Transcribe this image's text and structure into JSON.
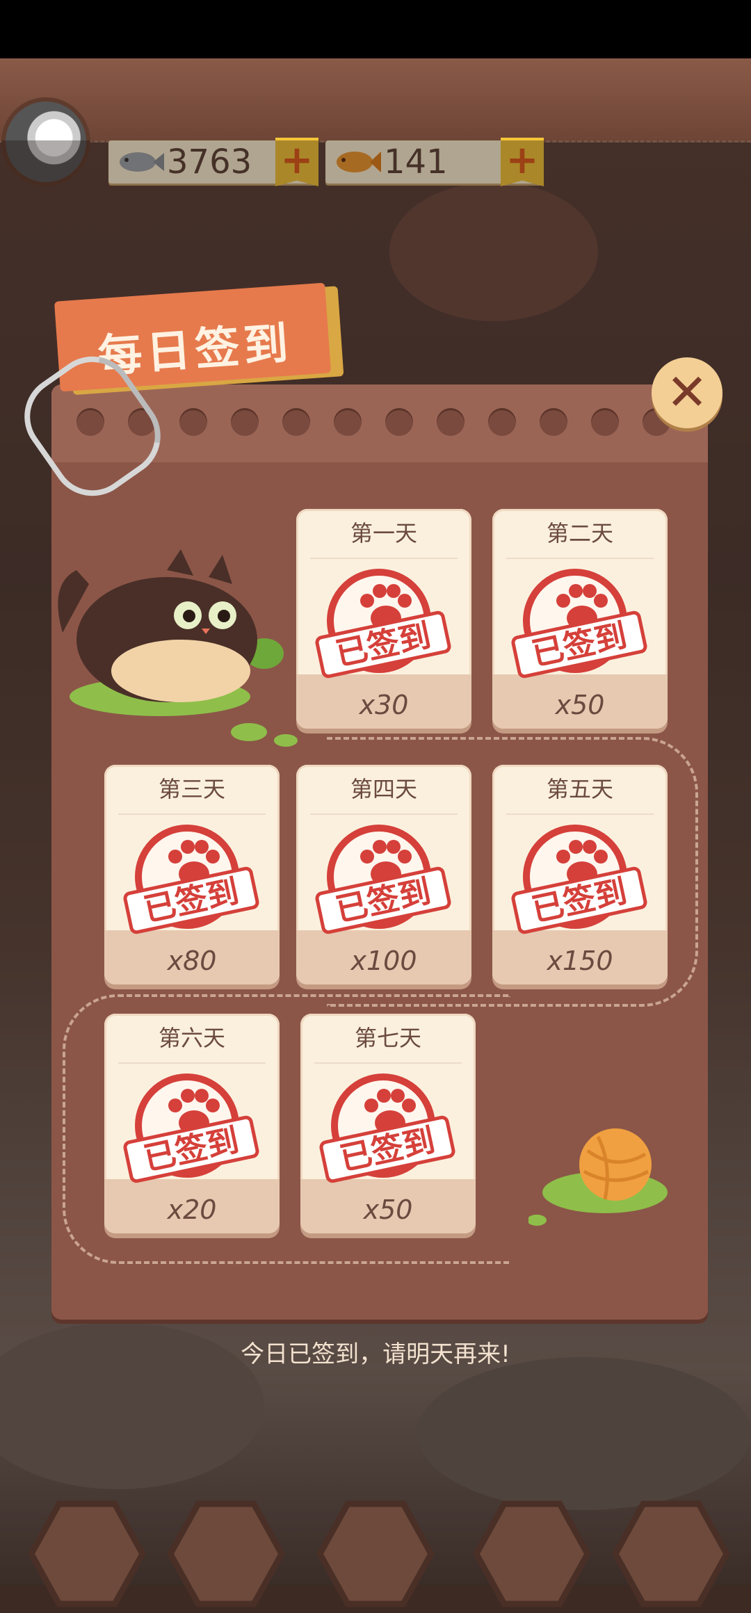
{
  "currency": {
    "fish_count": "3763",
    "gold_fish_count": "141",
    "plus_label": "+"
  },
  "dialog": {
    "title": "每日签到",
    "close_label": "✕",
    "days": [
      {
        "label": "第一天",
        "amount": "x30",
        "stamp": "已签到"
      },
      {
        "label": "第二天",
        "amount": "x50",
        "stamp": "已签到"
      },
      {
        "label": "第三天",
        "amount": "x80",
        "stamp": "已签到"
      },
      {
        "label": "第四天",
        "amount": "x100",
        "stamp": "已签到"
      },
      {
        "label": "第五天",
        "amount": "x150",
        "stamp": "已签到"
      },
      {
        "label": "第六天",
        "amount": "x20",
        "stamp": "已签到"
      },
      {
        "label": "第七天",
        "amount": "x50",
        "stamp": "已签到"
      }
    ]
  },
  "footer_message": "今日已签到，请明天再来!",
  "icons": {
    "avatar": "user-avatar",
    "fish": "fish-icon",
    "gold_fish": "gold-fish-icon",
    "close": "close-icon",
    "paw": "paw-icon"
  },
  "colors": {
    "panel": "#8b5648",
    "stamp_red": "#d5403a",
    "title_tag": "#e67a4d",
    "plus_yellow": "#f6c638"
  }
}
